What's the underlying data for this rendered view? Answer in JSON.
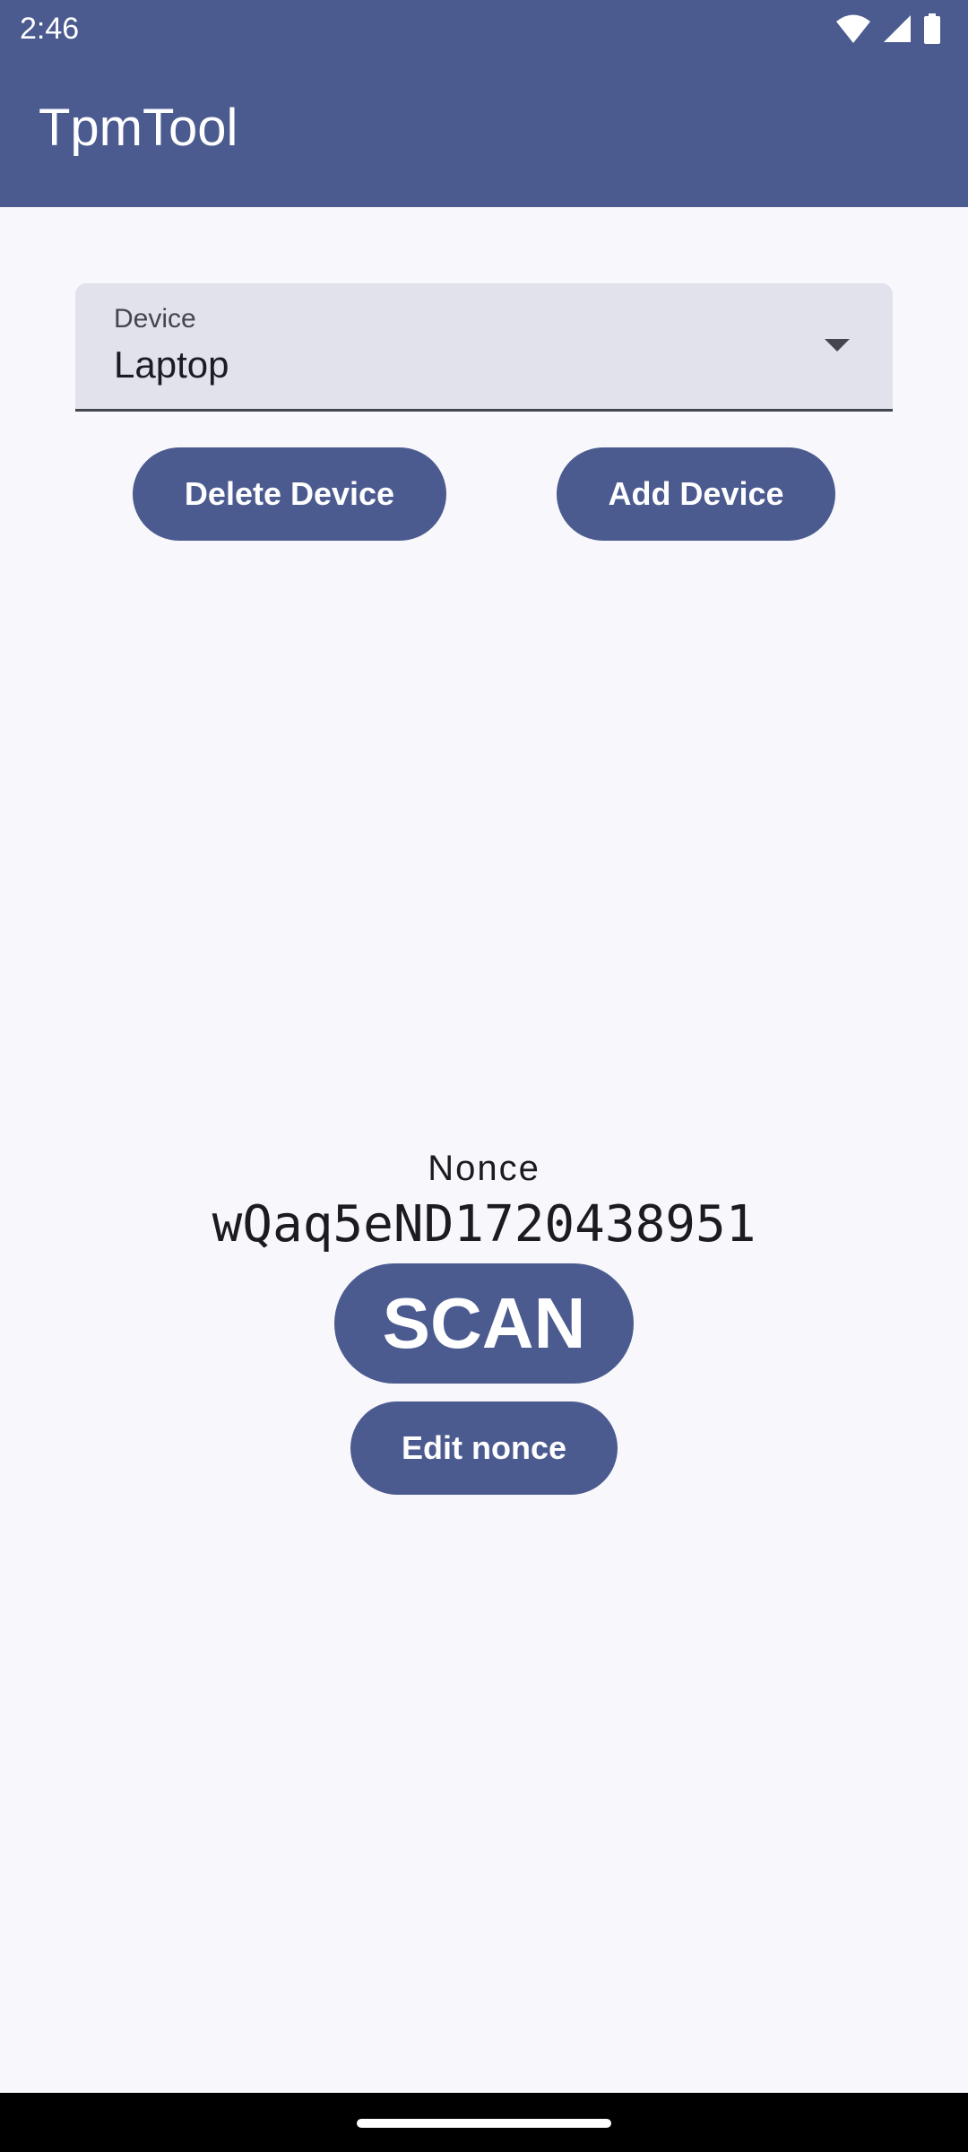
{
  "status_bar": {
    "time": "2:46",
    "icons": [
      "wifi-icon",
      "signal-icon",
      "battery-icon"
    ]
  },
  "app_bar": {
    "title": "TpmTool",
    "color": "#4b5b8f"
  },
  "device_select": {
    "label": "Device",
    "value": "Laptop"
  },
  "buttons": {
    "delete_device": "Delete Device",
    "add_device": "Add Device",
    "scan": "SCAN",
    "edit_nonce": "Edit nonce"
  },
  "nonce": {
    "label": "Nonce",
    "value": "wQaq5eND1720438951"
  },
  "colors": {
    "primary": "#4b5b8f",
    "background": "#f8f7fc",
    "field_background": "#e1e2ec"
  }
}
